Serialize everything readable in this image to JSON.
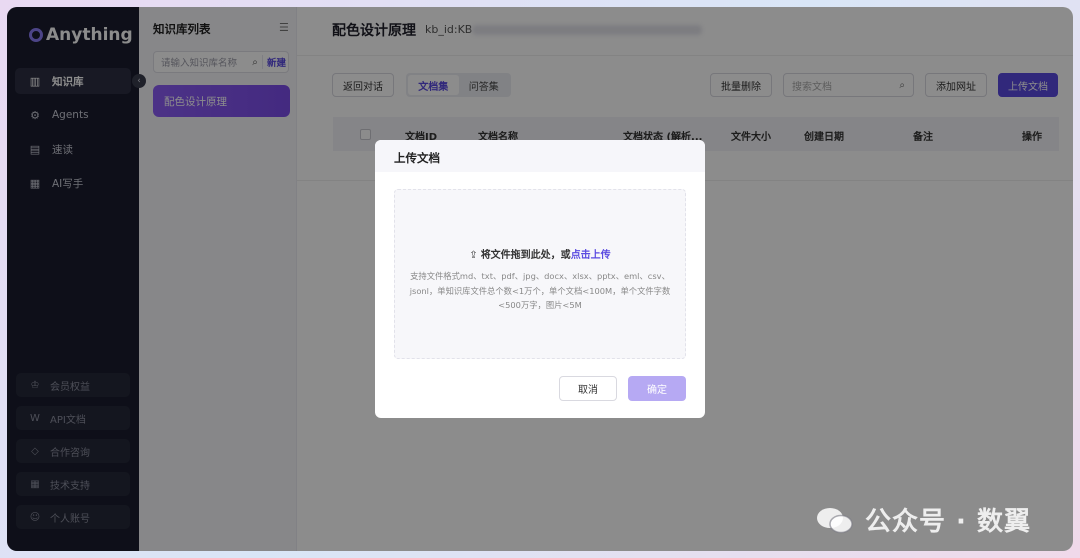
{
  "sidebar": {
    "logo": "Anything",
    "collapse_glyph": "‹",
    "nav": [
      {
        "label": "知识库",
        "icon": "book-icon",
        "glyph": "▥",
        "active": true
      },
      {
        "label": "Agents",
        "icon": "robot-icon",
        "glyph": "⚙",
        "active": false
      },
      {
        "label": "速读",
        "icon": "speed-read-icon",
        "glyph": "▤",
        "active": false
      },
      {
        "label": "AI写手",
        "icon": "writer-icon",
        "glyph": "▦",
        "active": false
      }
    ],
    "bottom": [
      {
        "label": "会员权益",
        "icon": "crown-icon",
        "glyph": "♔"
      },
      {
        "label": "API文档",
        "icon": "doc-w-icon",
        "glyph": "W"
      },
      {
        "label": "合作咨询",
        "icon": "diamond-icon",
        "glyph": "◇"
      },
      {
        "label": "技术支持",
        "icon": "grid-icon",
        "glyph": "▦"
      },
      {
        "label": "个人账号",
        "icon": "user-icon",
        "glyph": "☺"
      }
    ]
  },
  "kb_panel": {
    "title": "知识库列表",
    "menu_glyph": "☰",
    "search_placeholder": "请输入知识库名称",
    "search_glyph": "⌕",
    "new_label": "新建",
    "items": [
      "配色设计原理"
    ]
  },
  "main": {
    "title": "配色设计原理",
    "kb_id_prefix": "kb_id:KB",
    "back_label": "返回对话",
    "tabs": [
      "文档集",
      "问答集"
    ],
    "batch_delete": "批量删除",
    "search_placeholder": "搜索文档",
    "search_glyph": "⌕",
    "add_url": "添加网址",
    "upload": "上传文档",
    "table_headers": [
      "文档ID",
      "文档名称",
      "文档状态 (解析...",
      "文件大小",
      "创建日期",
      "备注",
      "操作"
    ]
  },
  "modal": {
    "title": "上传文档",
    "upload_glyph": "⇪",
    "drop_text": "将文件拖到此处，或",
    "drop_link": "点击上传",
    "desc": "支持文件格式md、txt、pdf、jpg、docx、xlsx、pptx、eml、csv、jsonl，单知识库文件总个数<1万个，单个文档<100M，单个文件字数<500万字，图片<5M",
    "cancel": "取消",
    "confirm": "确定"
  },
  "watermark": "公众号 · 数翼",
  "colors": {
    "accent": "#5a4ae0",
    "sidebar_bg": "#1a1d2e",
    "kb_item": "#8b5cf6"
  }
}
